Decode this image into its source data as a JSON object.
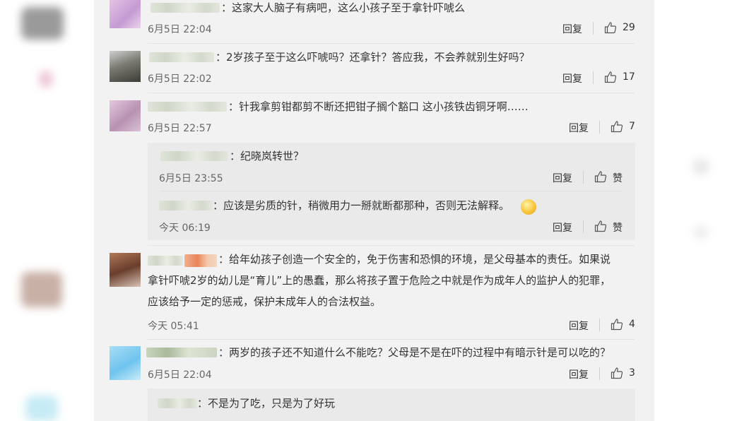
{
  "comments": [
    {
      "text": "：这家大人脑子有病吧，这么小孩子至于拿针吓唬么",
      "time": "6月5日 22:04",
      "reply": "回复",
      "likes": "29",
      "avatar_color": "#d9a8d8"
    },
    {
      "text": "：2岁孩子至于这么吓唬吗？还拿针？答应我，不会养就别生好吗？",
      "time": "6月5日 22:02",
      "reply": "回复",
      "likes": "17",
      "avatar_color": "#5a5a52"
    },
    {
      "text": "：针我拿剪钳都剪不断还把钳子搁个豁口 这小孩铁齿铜牙啊……",
      "time": "6月5日 22:57",
      "reply": "回复",
      "likes": "7",
      "avatar_color": "#c9a8c2",
      "replies": [
        {
          "text": "：纪晓岚转世？",
          "time": "6月5日 23:55",
          "reply": "回复",
          "likes": "赞"
        },
        {
          "text": "：应该是劣质的针，稍微用力一掰就断都那种，否则无法解释。",
          "time": "今天 06:19",
          "reply": "回复",
          "likes": "赞",
          "emoji": "grinning-face-emoji"
        }
      ]
    },
    {
      "lines": [
        "：给年幼孩子创造一个安全的，免于伤害和恐惧的环境，是父母基本的责任。如果说",
        "拿针吓唬2岁的幼儿是“育儿”上的愚蠢，那么将孩子置于危险之中就是作为成年人的监护人的犯罪，",
        "应该给予一定的惩戒，保护未成年人的合法权益。"
      ],
      "time": "今天 05:41",
      "reply": "回复",
      "likes": "4",
      "avatar_color": "#8a5a44"
    },
    {
      "text": "：两岁的孩子还不知道什么不能吃？父母是不是在吓的过程中有暗示针是可以吃的？",
      "time": "6月5日 22:04",
      "reply": "回复",
      "likes": "3",
      "avatar_color": "#8fd0f0",
      "replies": [
        {
          "text": "：不是为了吃，只是为了好玩"
        }
      ]
    }
  ],
  "icons": {
    "like": "thumbs-up-icon"
  },
  "colors": {
    "feed_bg": "#f2f2f2",
    "subreply_bg": "#eaeaea",
    "text": "#333333",
    "meta": "#666666"
  }
}
